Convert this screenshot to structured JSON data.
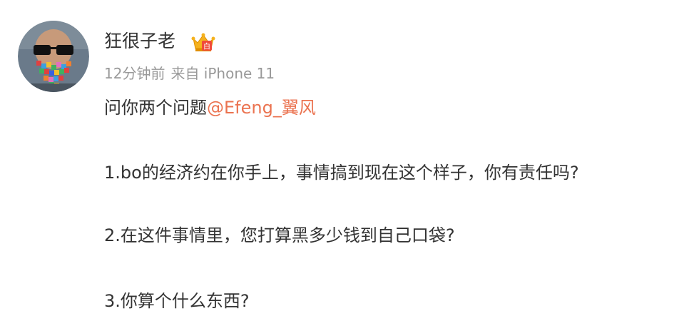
{
  "post": {
    "author": {
      "name": "狂很子老",
      "badge_icon": "crown-vip-icon"
    },
    "meta": {
      "time": "12分钟前",
      "source": "来自 iPhone 11"
    },
    "content": {
      "line1_prefix": "问你两个问题",
      "mention": "@Efeng_翼风",
      "line2": "1.bo的经济约在你手上，事情搞到现在这个样子，你有责任吗?",
      "line3": "2.在这件事情里，您打算黑多少钱到自己口袋?",
      "line4": "3.你算个什么东西?"
    }
  },
  "colors": {
    "text": "#333333",
    "meta": "#999999",
    "mention": "#eb7350",
    "background": "#ffffff"
  }
}
